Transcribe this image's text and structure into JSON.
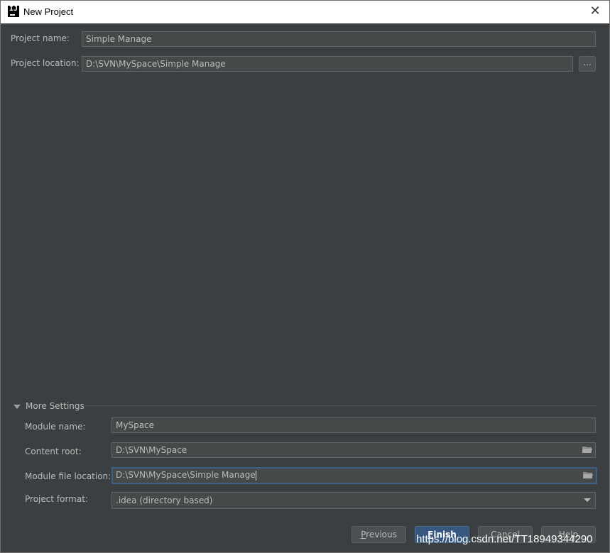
{
  "window": {
    "title": "New Project",
    "close_glyph": "✕"
  },
  "project": {
    "name_label": "Project name:",
    "name_value": "Simple Manage",
    "location_label": "Project location:",
    "location_value": "D:\\SVN\\MySpace\\Simple Manage",
    "browse_label": "..."
  },
  "more_settings": {
    "title": "More Settings",
    "module_name_label": "Module name:",
    "module_name_value": "MySpace",
    "content_root_label": "Content root:",
    "content_root_value": "D:\\SVN\\MySpace",
    "module_file_label": "Module file location:",
    "module_file_value": "D:\\SVN\\MySpace\\Simple Manage",
    "project_format_label": "Project format:",
    "project_format_value": ".idea (directory based)"
  },
  "buttons": {
    "previous_first": "P",
    "previous_rest": "revious",
    "finish_first": "F",
    "finish_rest": "inish",
    "cancel": "Cancel",
    "help": "Help"
  },
  "watermark": "https://blog.csdn.net/TT18949344290",
  "colors": {
    "background": "#3c3f41",
    "field": "#45494a",
    "focus": "#3d6185",
    "default_button": "#365880"
  }
}
